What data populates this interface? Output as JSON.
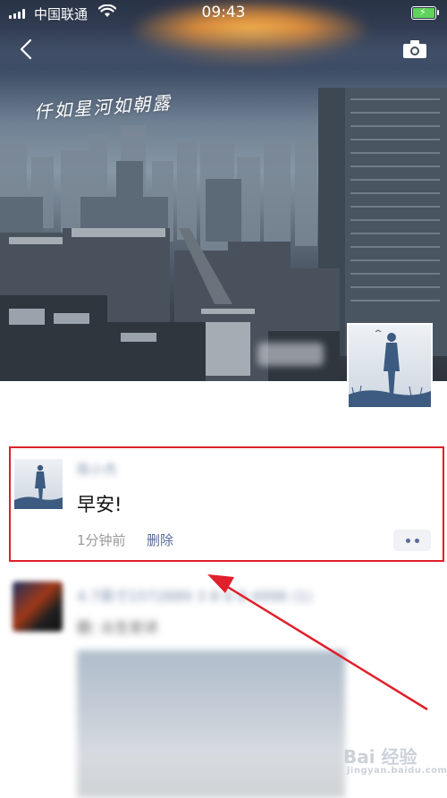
{
  "status_bar": {
    "carrier": "中国联通",
    "time": "09:43"
  },
  "cover": {
    "handwritten_caption": "仟如星河如朝露",
    "blurred_username": "·· ··"
  },
  "post": {
    "author": "陈小杰",
    "text": "早安!",
    "time": "1分钟前",
    "delete_label": "删除"
  },
  "next_post": {
    "line1": "4.7英寸1572889 3 8 6 8 4996 (1)",
    "line2": "题: 众生安详"
  },
  "watermark": {
    "brand": "Bai 经验",
    "url": "jingyan.baidu.com"
  },
  "colors": {
    "link_blue": "#576b95",
    "highlight_red": "#e0202a",
    "battery_green": "#5fd35b"
  }
}
